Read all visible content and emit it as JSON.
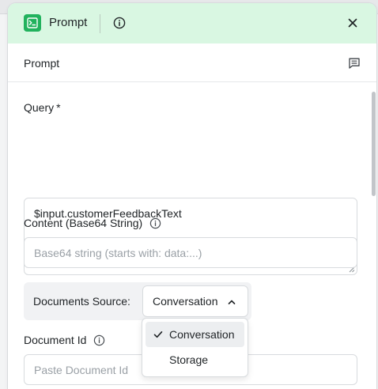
{
  "panel": {
    "title": "Prompt",
    "header_bg": "#d9f7e2",
    "icon_color": "#21b25d",
    "icons": [
      "prompt-node-icon",
      "info-icon",
      "close-icon"
    ]
  },
  "section": {
    "title": "Prompt",
    "icon": "comment-icon"
  },
  "form": {
    "query": {
      "label": "Query",
      "required_mark": "*",
      "value": "$input.customerFeedbackText"
    },
    "content": {
      "label": "Content (Base64 String)",
      "placeholder": "Base64 string (starts with: data:...)"
    },
    "documents_source": {
      "label": "Documents Source:",
      "selected": "Conversation",
      "options": [
        {
          "label": "Conversation",
          "selected": true
        },
        {
          "label": "Storage",
          "selected": false
        }
      ]
    },
    "document_id": {
      "label": "Document Id",
      "placeholder": "Paste Document Id"
    }
  }
}
